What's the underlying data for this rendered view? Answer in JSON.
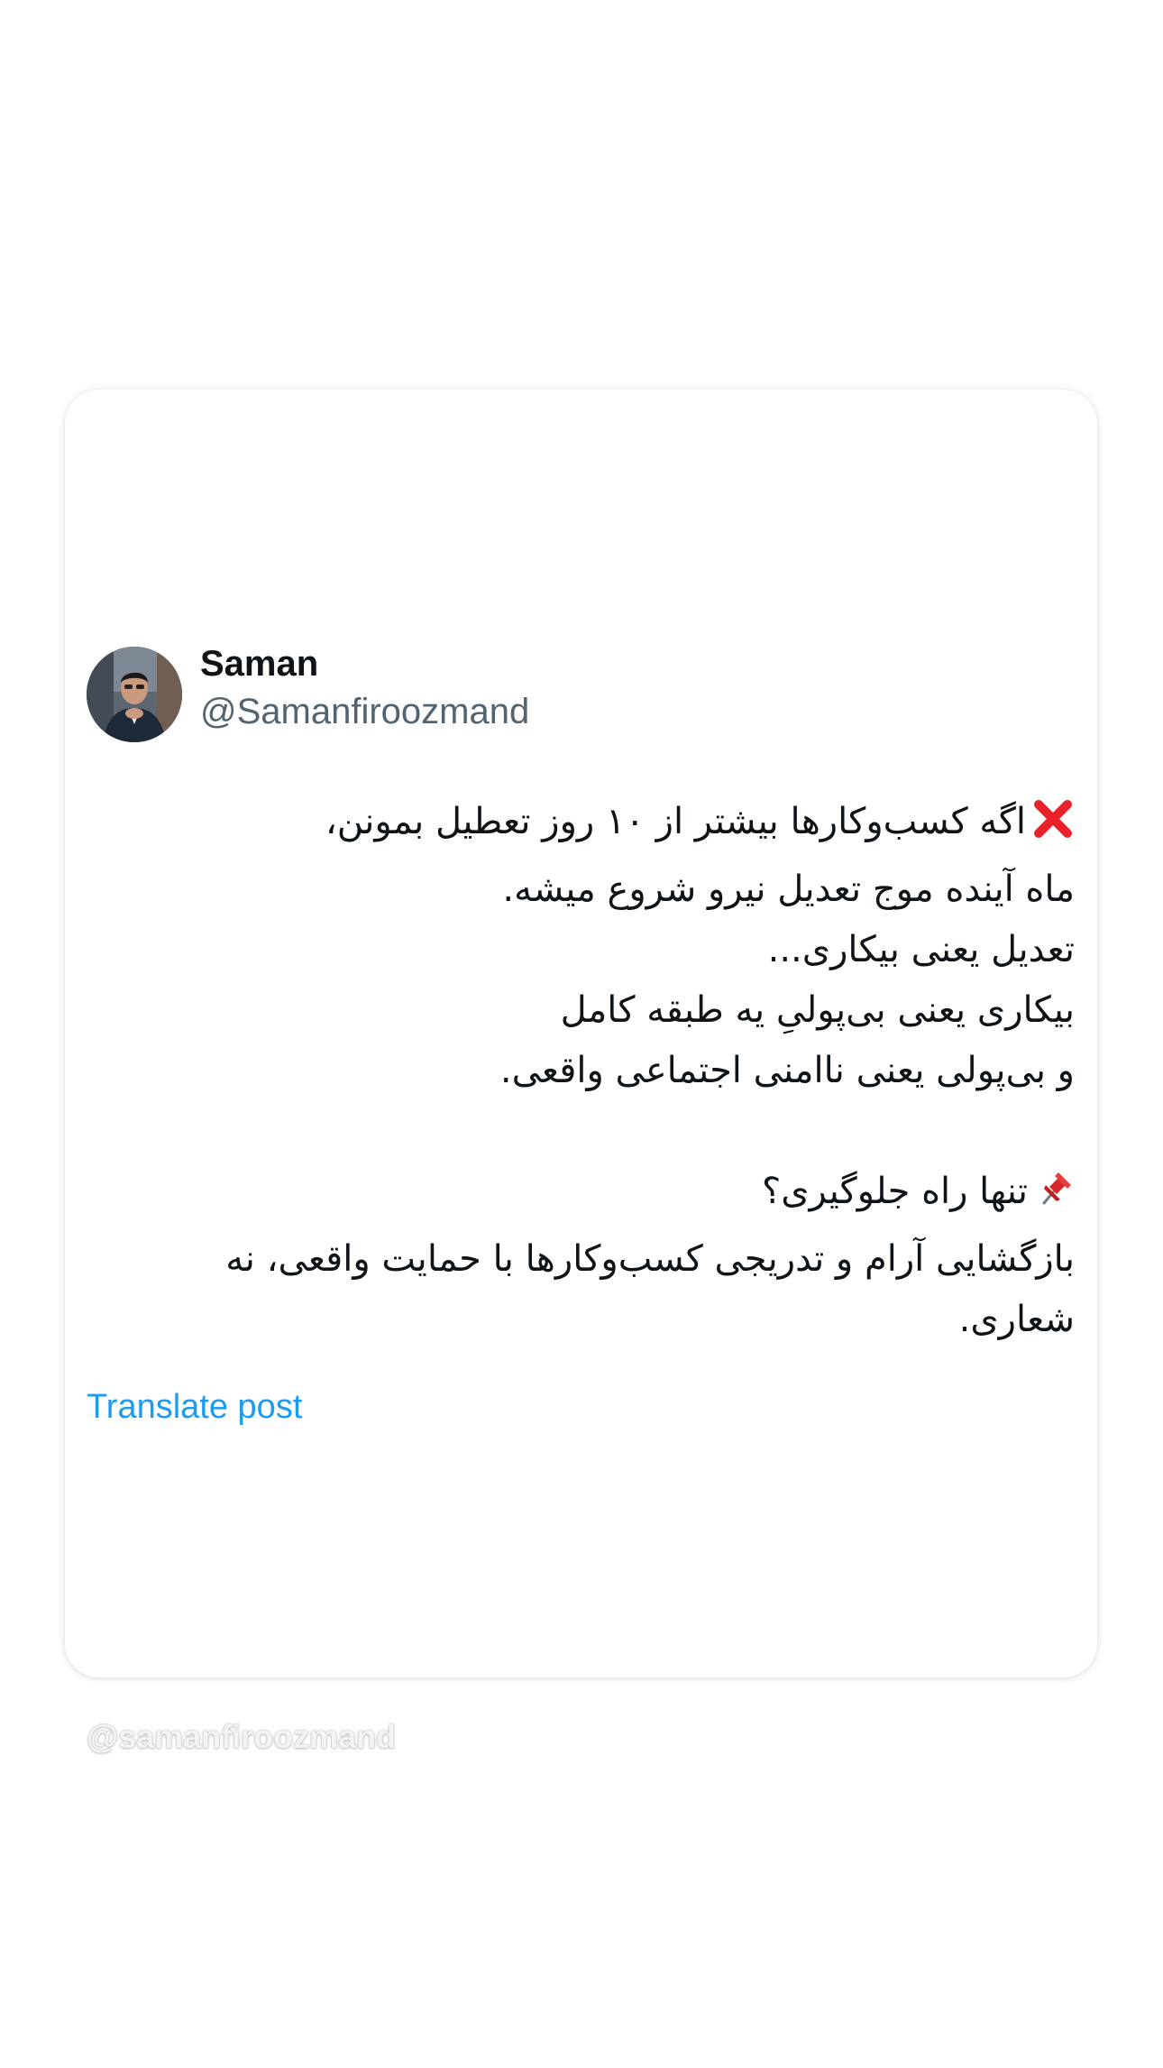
{
  "author": {
    "display_name": "Saman",
    "handle": "@Samanfiroozmand",
    "avatar_icon": "profile-photo"
  },
  "post": {
    "lines": [
      "اگه کسب‌وکارها بیشتر از ۱۰ روز تعطیل بمونن،",
      "ماه آینده موج تعدیل نیرو شروع میشه.",
      "تعدیل یعنی بیکاری...",
      "بیکاری یعنی بی‌پولیِ یه طبقه کامل",
      "و بی‌پولی یعنی ناامنی اجتماعی واقعی.",
      "",
      "تنها راه جلوگیری؟",
      "بازگشایی آرام و تدریجی کسب‌وکارها با حمایت واقعی، نه شعاری."
    ],
    "line1_icon": "cross-mark-icon",
    "line7_icon": "pushpin-icon"
  },
  "translate_label": "Translate post",
  "watermark": "@samanfiroozmand",
  "colors": {
    "background": "#ffffff",
    "card": "#ffffff",
    "text_primary": "#0f1419",
    "text_secondary": "#536471",
    "link": "#1d9bf0",
    "cross_mark": "#e8212b"
  }
}
